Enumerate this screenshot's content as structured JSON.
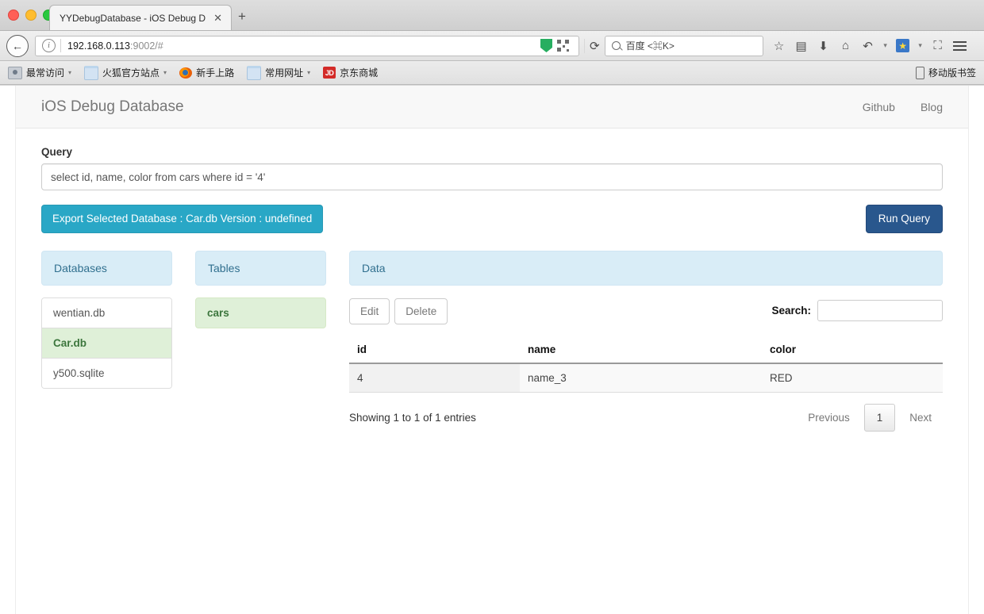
{
  "browser": {
    "tab": {
      "title": "YYDebugDatabase - iOS Debug D",
      "close_label": "✕",
      "new_tab_label": "+"
    },
    "address": {
      "host": "192.168.0.113",
      "port_path": ":9002/#",
      "back_label": "←",
      "info_label": "i",
      "reload_label": "⟳"
    },
    "search": {
      "placeholder": "百度 <⌘K>"
    },
    "toolbar_icons": [
      {
        "name": "bookmark-star-icon",
        "glyph": "☆"
      },
      {
        "name": "reader-list-icon",
        "glyph": "▤"
      },
      {
        "name": "downloads-icon",
        "glyph": "⬇"
      },
      {
        "name": "home-icon",
        "glyph": "⌂"
      },
      {
        "name": "history-back-arrow-icon",
        "glyph": "↶"
      },
      {
        "name": "caret-down-icon",
        "glyph": "▾"
      },
      {
        "name": "favorites-star-icon",
        "glyph": "★"
      },
      {
        "name": "caret-down-icon-2",
        "glyph": "▾"
      },
      {
        "name": "screenshot-crop-icon",
        "glyph": "⛶"
      }
    ],
    "bookmarks": [
      {
        "label": "最常访问",
        "icon": "camera-icon",
        "caret": "▾"
      },
      {
        "label": "火狐官方站点",
        "icon": "folder-icon",
        "caret": "▾"
      },
      {
        "label": "新手上路",
        "icon": "firefox-icon",
        "caret": ""
      },
      {
        "label": "常用网址",
        "icon": "folder-icon",
        "caret": "▾"
      },
      {
        "label": "京东商城",
        "icon": "jd-icon",
        "caret": ""
      }
    ],
    "bookmarks_right": {
      "label": "移动版书签",
      "icon": "mobile-phone-icon"
    }
  },
  "app": {
    "brand": "iOS Debug Database",
    "nav_links": [
      {
        "label": "Github"
      },
      {
        "label": "Blog"
      }
    ],
    "query": {
      "label": "Query",
      "value": "select id, name, color from cars where id = '4'",
      "placeholder": ""
    },
    "buttons": {
      "export": "Export Selected Database : Car.db Version : undefined",
      "run": "Run Query"
    },
    "panels": {
      "databases": {
        "title": "Databases",
        "items": [
          {
            "label": "wentian.db",
            "active": false
          },
          {
            "label": "Car.db",
            "active": true
          },
          {
            "label": "y500.sqlite",
            "active": false
          }
        ]
      },
      "tables": {
        "title": "Tables",
        "items": [
          {
            "label": "cars",
            "active": true
          }
        ]
      },
      "data": {
        "title": "Data",
        "edit_label": "Edit",
        "delete_label": "Delete",
        "search_label": "Search:",
        "search_value": "",
        "search_placeholder": "",
        "columns": [
          "id",
          "name",
          "color"
        ],
        "rows": [
          {
            "id": "4",
            "name": "name_3",
            "color": "RED"
          }
        ],
        "entries_info": "Showing 1 to 1 of 1 entries",
        "pagination": {
          "previous": "Previous",
          "current_page": "1",
          "next": "Next"
        }
      }
    }
  },
  "colors": {
    "export_button": "#29a7c6",
    "run_button": "#29578d",
    "panel_header": "#d9edf7",
    "panel_header_text": "#31708f",
    "active_item_bg": "#dff0d8",
    "active_item_text": "#3c763d"
  }
}
